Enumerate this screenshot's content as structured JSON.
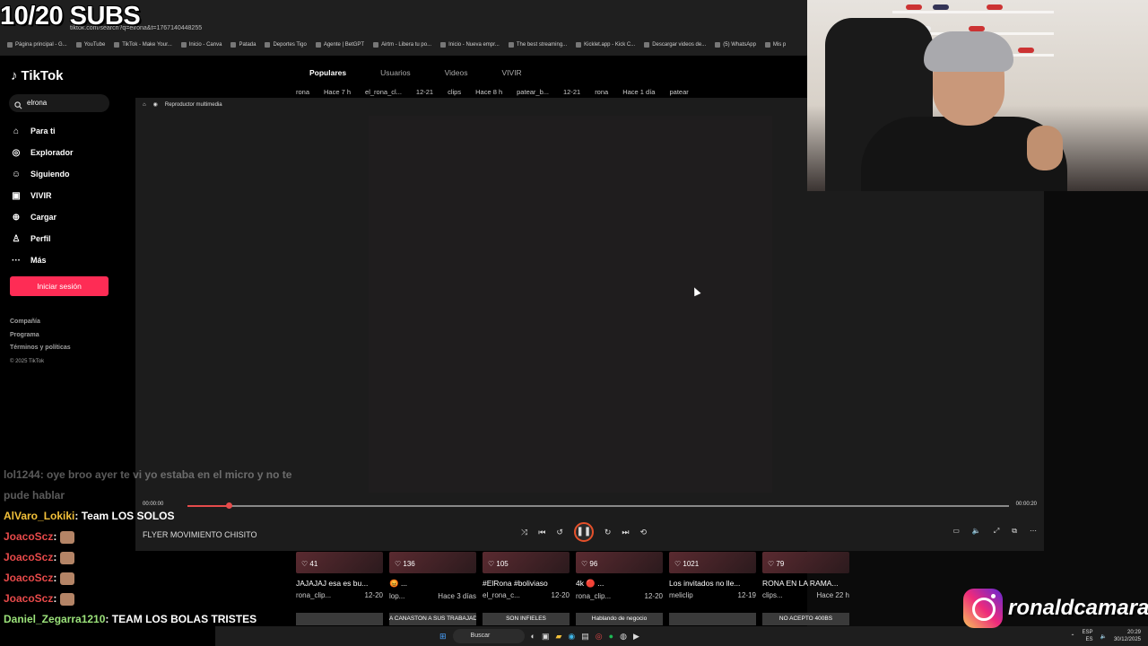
{
  "overlay": {
    "subs": "10/20 SUBS"
  },
  "browser": {
    "url": "tiktok.com/search?q=elrona&t=1767140448255",
    "bookmarks": [
      "Página principal - G...",
      "YouTube",
      "TikTok - Make Your...",
      "Inicio - Canva",
      "Patada",
      "Deportes Tigo",
      "Agente | BetGPT",
      "Airtm - Libera tu po...",
      "Inicio - Nueva empr...",
      "The best streaming...",
      "Kicklet.app - Kick C...",
      "Descargar videos de...",
      "(5) WhatsApp",
      "Mis p"
    ]
  },
  "tiktok": {
    "logo": "TikTok",
    "search_value": "elrona",
    "nav": [
      {
        "icon": "home-icon",
        "glyph": "⌂",
        "label": "Para ti"
      },
      {
        "icon": "compass-icon",
        "glyph": "◎",
        "label": "Explorador"
      },
      {
        "icon": "users-icon",
        "glyph": "☺",
        "label": "Siguiendo"
      },
      {
        "icon": "live-icon",
        "glyph": "▣",
        "label": "VIVIR"
      },
      {
        "icon": "upload-icon",
        "glyph": "⊕",
        "label": "Cargar"
      },
      {
        "icon": "profile-icon",
        "glyph": "♙",
        "label": "Perfil"
      },
      {
        "icon": "more-icon",
        "glyph": "···",
        "label": "Más"
      }
    ],
    "login_label": "Iniciar sesión",
    "footer": [
      "Compañía",
      "Programa",
      "Términos y políticas"
    ],
    "copyright": "© 2025 TikTok",
    "tabs": [
      "Populares",
      "Usuarios",
      "Videos",
      "VIVIR"
    ],
    "peek": [
      "rona",
      "Hace 7 h",
      "el_rona_cl...",
      "12-21",
      "clips",
      "Hace 8 h",
      "patear_b...",
      "12-21",
      "rona",
      "Hace 1 día",
      "patear"
    ]
  },
  "player": {
    "title": "Reproductor multimedia",
    "time_start": "00:00:00",
    "time_end": "00:00:20",
    "progress": 0.05,
    "media_name": "FLYER MOVIMIENTO CHISITO"
  },
  "thumbs": [
    {
      "likes": "♡ 41",
      "caption": "JAJAJAJ esa es bu...",
      "user": "rona_clip...",
      "date": "12-20"
    },
    {
      "likes": "♡ 136",
      "caption": "😡 ...",
      "user": "lop...",
      "date": "Hace 3 días"
    },
    {
      "likes": "♡ 105",
      "caption": "#ElRona #boliviaso",
      "user": "el_rona_c...",
      "date": "12-20"
    },
    {
      "likes": "♡ 96",
      "caption": "4k 🔴 ...",
      "user": "rona_clip...",
      "date": "12-20"
    },
    {
      "likes": "♡ 1021",
      "caption": "Los invitados no lle...",
      "user": "meliclip",
      "date": "12-19"
    },
    {
      "likes": "♡ 79",
      "caption": "RONA EN LA RAMA...",
      "user": "clips...",
      "date": "Hace 22 h"
    }
  ],
  "thumbs2": [
    "",
    "A CANASTON A SUS TRABAJADORES",
    "SON INFIELES",
    "Hablando de negocio",
    "",
    "NO ACEPTO 400BS"
  ],
  "chat": [
    {
      "user": "lol1244",
      "text": ": oye broo ayer te vi yo estaba en el micro y no te pude hablar",
      "style": "faded"
    },
    {
      "user": "AlVaro_Lokiki",
      "text": ": Team LOS SOLOS",
      "style": "u1"
    },
    {
      "user": "JoacoScz",
      "text": ":",
      "style": "u2"
    },
    {
      "user": "JoacoScz",
      "text": ":",
      "style": "u2"
    },
    {
      "user": "JoacoScz",
      "text": ":",
      "style": "u2"
    },
    {
      "user": "JoacoScz",
      "text": ":",
      "style": "u2"
    },
    {
      "user": "Daniel_Zegarra1210",
      "text": ": TEAM LOS BOLAS TRISTES",
      "style": "u3"
    }
  ],
  "instagram": {
    "handle": "ronaldcamaras"
  },
  "taskbar": {
    "search": "Buscar",
    "lang1": "ESP",
    "lang2": "ES",
    "time": "20:29",
    "date": "30/12/2025"
  }
}
